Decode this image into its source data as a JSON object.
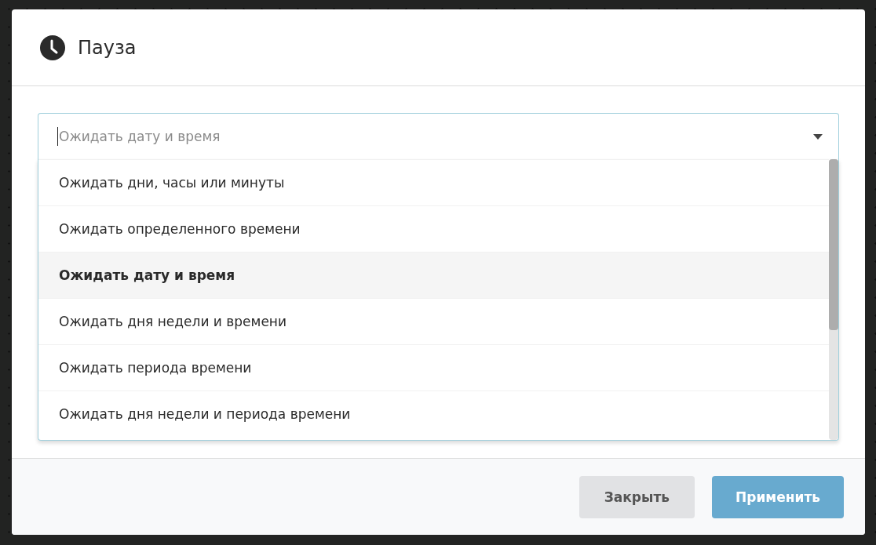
{
  "dialog": {
    "title": "Пауза"
  },
  "select": {
    "placeholder": "Ожидать дату и время",
    "expanded": true
  },
  "options": [
    {
      "label": "Ожидать дни, часы или минуты",
      "hovered": false
    },
    {
      "label": "Ожидать определенного времени",
      "hovered": false
    },
    {
      "label": "Ожидать дату и время",
      "hovered": true
    },
    {
      "label": "Ожидать дня недели и времени",
      "hovered": false
    },
    {
      "label": "Ожидать периода времени",
      "hovered": false
    },
    {
      "label": "Ожидать дня недели и периода времени",
      "hovered": false
    }
  ],
  "buttons": [
    {
      "label": "Закрыть",
      "kind": "secondary"
    },
    {
      "label": "Применить",
      "kind": "primary"
    }
  ]
}
